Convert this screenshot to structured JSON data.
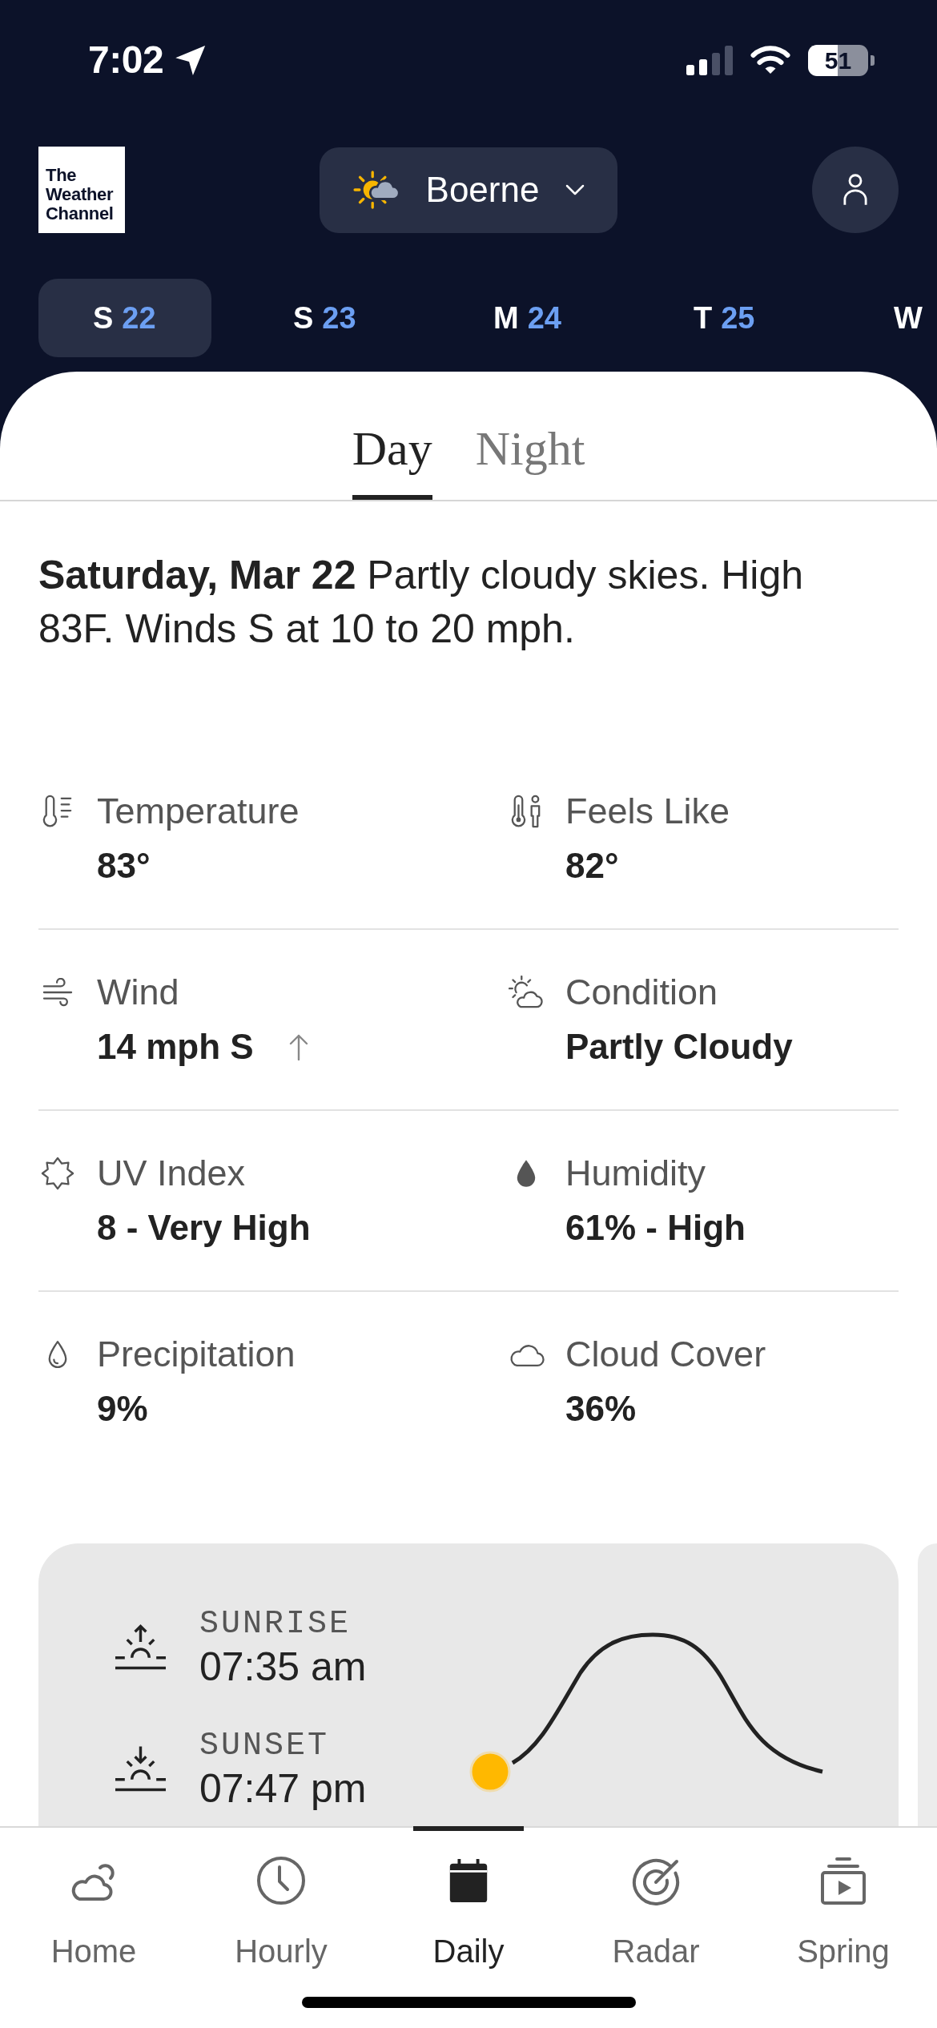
{
  "status_bar": {
    "time": "7:02",
    "battery": "51"
  },
  "header": {
    "logo": "The Weather Channel",
    "location": "Boerne"
  },
  "day_tabs": [
    {
      "day": "S",
      "date": "22",
      "selected": true
    },
    {
      "day": "S",
      "date": "23",
      "selected": false
    },
    {
      "day": "M",
      "date": "24",
      "selected": false
    },
    {
      "day": "T",
      "date": "25",
      "selected": false
    },
    {
      "day": "W",
      "selected": false
    }
  ],
  "view_tabs": [
    {
      "label": "Day",
      "selected": true
    },
    {
      "label": "Night",
      "selected": false
    }
  ],
  "summary": "**Saturday, Mar 22** Partly cloudy skies. High 83F. Winds S at 10 to 20 mph.",
  "details": [
    {
      "kind": "temperature",
      "label": "Temperature",
      "value": "83°"
    },
    {
      "kind": "feels_like",
      "label": "Feels Like",
      "value": "82°"
    },
    {
      "kind": "wind",
      "label": "Wind",
      "value": "14 mph S"
    },
    {
      "kind": "condition",
      "label": "Condition",
      "value": "Partly Cloudy"
    },
    {
      "kind": "uv",
      "label": "UV Index",
      "value": "8 - Very High"
    },
    {
      "kind": "humidity",
      "label": "Humidity",
      "value": "61% - High"
    },
    {
      "kind": "precipitation",
      "label": "Precipitation",
      "value": "9%"
    },
    {
      "kind": "cloud_cover",
      "label": "Cloud Cover",
      "value": "36%"
    }
  ],
  "sun_card": {
    "events": [
      {
        "kind": "sunrise",
        "label": "SUNRISE",
        "time": "07:35 am"
      },
      {
        "kind": "sunset",
        "label": "SUNSET",
        "time": "07:47 pm"
      }
    ]
  },
  "bottom_nav": [
    {
      "kind": "home",
      "label": "Home",
      "selected": false
    },
    {
      "kind": "hourly",
      "label": "Hourly",
      "selected": false
    },
    {
      "kind": "daily",
      "label": "Daily",
      "selected": true
    },
    {
      "kind": "radar",
      "label": "Radar",
      "selected": false
    },
    {
      "kind": "spring",
      "label": "Spring",
      "selected": false
    }
  ]
}
